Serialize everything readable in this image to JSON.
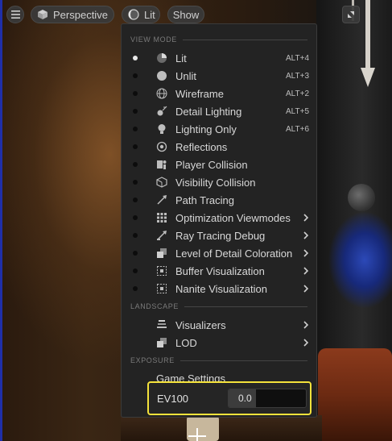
{
  "toolbar": {
    "perspective_label": "Perspective",
    "viewmode_label": "Lit",
    "show_label": "Show"
  },
  "menu": {
    "sections": {
      "view_mode": "VIEW MODE",
      "landscape": "LANDSCAPE",
      "exposure": "EXPOSURE"
    },
    "view_modes": [
      {
        "label": "Lit",
        "shortcut": "ALT+4",
        "selected": true,
        "icon": "lit-sphere-icon"
      },
      {
        "label": "Unlit",
        "shortcut": "ALT+3",
        "icon": "unlit-sphere-icon"
      },
      {
        "label": "Wireframe",
        "shortcut": "ALT+2",
        "icon": "wireframe-sphere-icon"
      },
      {
        "label": "Detail Lighting",
        "shortcut": "ALT+5",
        "icon": "detail-lighting-icon"
      },
      {
        "label": "Lighting Only",
        "shortcut": "ALT+6",
        "icon": "lightbulb-icon"
      },
      {
        "label": "Reflections",
        "icon": "reflections-icon"
      },
      {
        "label": "Player Collision",
        "icon": "player-collision-icon"
      },
      {
        "label": "Visibility Collision",
        "icon": "visibility-collision-icon"
      },
      {
        "label": "Path Tracing",
        "icon": "path-tracing-icon"
      },
      {
        "label": "Optimization Viewmodes",
        "submenu": true,
        "icon": "optimization-grid-icon"
      },
      {
        "label": "Ray Tracing Debug",
        "submenu": true,
        "icon": "ray-tracing-icon"
      },
      {
        "label": "Level of Detail Coloration",
        "submenu": true,
        "icon": "lod-coloration-icon"
      },
      {
        "label": "Buffer Visualization",
        "submenu": true,
        "icon": "buffer-visualization-icon"
      },
      {
        "label": "Nanite Visualization",
        "submenu": true,
        "icon": "nanite-visualization-icon"
      }
    ],
    "landscape_items": [
      {
        "label": "Visualizers",
        "submenu": true,
        "icon": "visualizers-icon"
      },
      {
        "label": "LOD",
        "submenu": true,
        "icon": "lod-icon"
      }
    ],
    "exposure": {
      "game_settings_label": "Game Settings",
      "ev100_label": "EV100",
      "ev100_value": "0.0"
    }
  },
  "colors": {
    "highlight_border": "#f4e23b",
    "menu_bg": "#232323"
  }
}
